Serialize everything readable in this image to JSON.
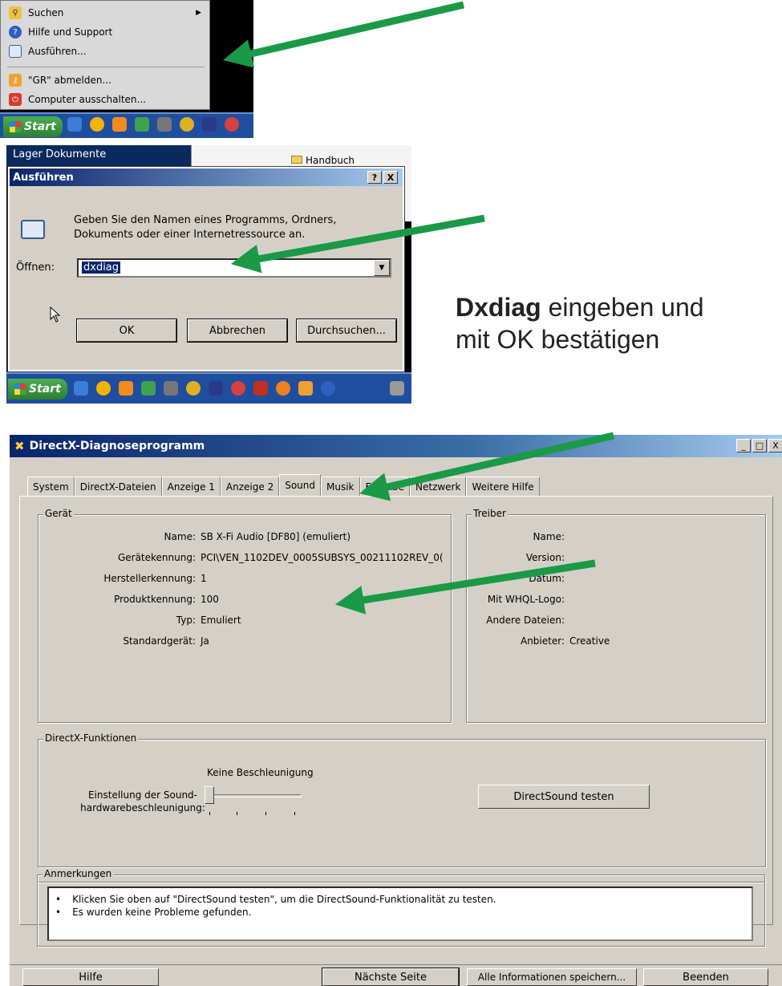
{
  "start_menu": {
    "items": [
      {
        "label": "Suchen",
        "icon": "search-icon"
      },
      {
        "label": "Hilfe und Support",
        "icon": "help-icon"
      },
      {
        "label": "Ausführen...",
        "icon": "run-icon"
      },
      {
        "label": "\"GR\" abmelden...",
        "icon": "logoff-icon"
      },
      {
        "label": "Computer ausschalten...",
        "icon": "power-icon"
      }
    ],
    "start_label": "Start"
  },
  "run_screenshot": {
    "background_text": "Lager Dokumente",
    "explorer_item": "Handbuch",
    "dialog": {
      "title": "Ausführen",
      "description": "Geben Sie den Namen eines Programms, Ordners, Dokuments oder einer Internetressource an.",
      "open_label": "Öffnen:",
      "input_value": "dxdiag",
      "ok": "OK",
      "cancel": "Abbrechen",
      "browse": "Durchsuchen...",
      "help_btn": "?",
      "close_btn": "X"
    },
    "start_label": "Start"
  },
  "caption": {
    "bold": "Dxdiag",
    "line1_rest": " eingeben und",
    "line2": "mit OK bestätigen"
  },
  "directx": {
    "title": "DirectX-Diagnoseprogramm",
    "tabs": [
      "System",
      "DirectX-Dateien",
      "Anzeige 1",
      "Anzeige 2",
      "Sound",
      "Musik",
      "Eingabe",
      "Netzwerk",
      "Weitere Hilfe"
    ],
    "device": {
      "title": "Gerät",
      "rows": [
        {
          "label": "Name:",
          "value": "SB X-Fi Audio [DF80] (emuliert)"
        },
        {
          "label": "Gerätekennung:",
          "value": "PCI\\VEN_1102DEV_0005SUBSYS_00211102REV_0("
        },
        {
          "label": "Herstellerkennung:",
          "value": "1"
        },
        {
          "label": "Produktkennung:",
          "value": "100"
        },
        {
          "label": "Typ:",
          "value": "Emuliert"
        },
        {
          "label": "Standardgerät:",
          "value": "Ja"
        }
      ]
    },
    "driver": {
      "title": "Treiber",
      "rows": [
        {
          "label": "Name:",
          "value": ""
        },
        {
          "label": "Version:",
          "value": ""
        },
        {
          "label": "Datum:",
          "value": ""
        },
        {
          "label": "Mit WHQL-Logo:",
          "value": ""
        },
        {
          "label": "Andere Dateien:",
          "value": ""
        },
        {
          "label": "Anbieter:",
          "value": "Creative"
        }
      ]
    },
    "functions": {
      "title": "DirectX-Funktionen",
      "accel_label_1": "Einstellung der Sound-",
      "accel_label_2": "hardwarebeschleunigung:",
      "slider_caption": "Keine Beschleunigung",
      "slider_level": 0,
      "test_button": "DirectSound testen"
    },
    "notes": {
      "title": "Anmerkungen",
      "lines": [
        "Klicken Sie oben auf \"DirectSound testen\", um die DirectSound-Funktionalität zu testen.",
        "Es wurden keine Probleme gefunden."
      ]
    },
    "buttons": {
      "help": "Hilfe",
      "next": "Nächste Seite",
      "save": "Alle Informationen speichern...",
      "exit": "Beenden"
    }
  },
  "colors": {
    "arrow": "#1a9a47",
    "title_bar": "#0a246a",
    "taskbar": "#1f4e9e",
    "dialog_face": "#d4d0c8"
  }
}
